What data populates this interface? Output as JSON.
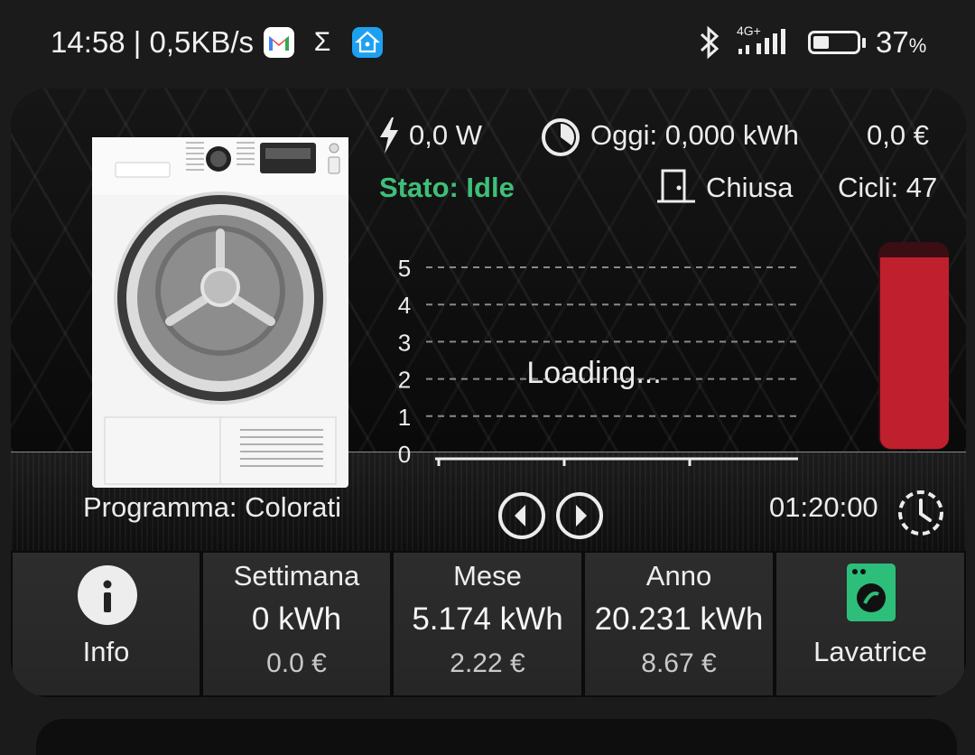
{
  "statusbar": {
    "time_speed": "14:58 | 0,5KB/s",
    "network_type": "4G+",
    "battery_percent": "37",
    "battery_percent_sign": "%",
    "battery_level": 0.37,
    "icons": [
      "gmail-icon",
      "sigma-icon",
      "home-assistant-icon",
      "bluetooth-icon",
      "signal-icon",
      "battery-icon"
    ]
  },
  "device": {
    "power": "0,0 W",
    "today_energy": "Oggi: 0,000 kWh",
    "today_cost": "0,0 €",
    "state": "Stato: Idle",
    "door": "Chiusa",
    "cycles": "Cicli: 47",
    "program": "Programma: Colorati",
    "remaining_time": "01:20:00"
  },
  "chart_data": {
    "type": "line",
    "title": "",
    "status_text": "Loading...",
    "yticks": [
      "0",
      "1",
      "2",
      "3",
      "4",
      "5"
    ],
    "ylim": [
      0,
      5
    ],
    "x": [],
    "series": [],
    "grid": true
  },
  "level_bar": {
    "value": 0.93,
    "color": "#c0202e"
  },
  "tiles": {
    "info": {
      "label": "Info"
    },
    "week": {
      "label": "Settimana",
      "energy": "0 kWh",
      "cost": "0.0 €"
    },
    "month": {
      "label": "Mese",
      "energy": "5.174 kWh",
      "cost": "2.22 €"
    },
    "year": {
      "label": "Anno",
      "energy": "20.231 kWh",
      "cost": "8.67 €"
    },
    "washer": {
      "label": "Lavatrice"
    }
  },
  "colors": {
    "accent_green": "#3fbf78",
    "bar_red": "#c0202e",
    "washer_icon_green": "#2dbf7a"
  }
}
